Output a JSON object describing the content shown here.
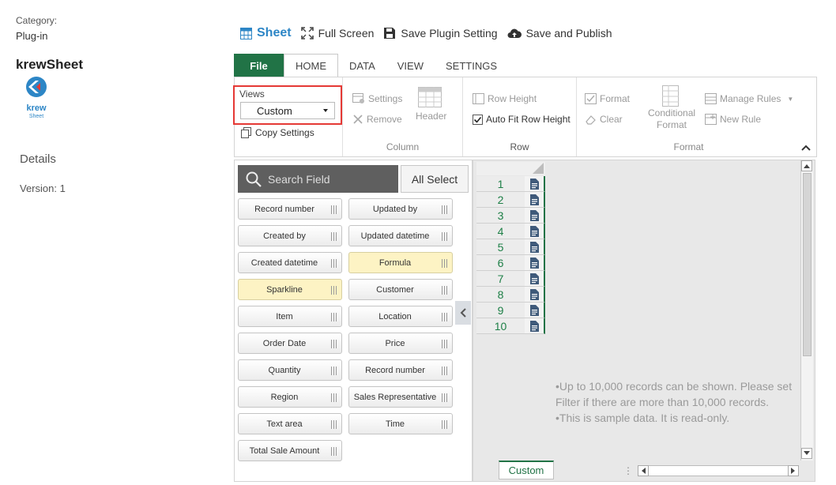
{
  "sidebar": {
    "category_label": "Category:",
    "category_value": "Plug-in",
    "plugin_name": "krewSheet",
    "logo_text": "krew",
    "logo_subtext": "Sheet",
    "details_label": "Details",
    "version_text": "Version: 1"
  },
  "toolbar": {
    "sheet_label": "Sheet",
    "fullscreen_label": "Full Screen",
    "save_plugin_label": "Save Plugin Setting",
    "save_publish_label": "Save and Publish"
  },
  "tabs": [
    "File",
    "HOME",
    "DATA",
    "VIEW",
    "SETTINGS"
  ],
  "ribbon": {
    "views_label": "Views",
    "views_selected": "Custom",
    "copy_settings": "Copy Settings",
    "column": {
      "settings": "Settings",
      "remove": "Remove",
      "header": "Header",
      "label": "Column"
    },
    "row": {
      "row_height": "Row Height",
      "auto_fit": "Auto Fit Row Height",
      "label": "Row"
    },
    "format": {
      "format": "Format",
      "clear": "Clear",
      "conditional_line1": "Conditional",
      "conditional_line2": "Format",
      "manage_rules": "Manage Rules",
      "new_rule": "New Rule",
      "label": "Format"
    }
  },
  "field_panel": {
    "search_placeholder": "Search Field",
    "all_select": "All Select",
    "fields": [
      {
        "label": "Record number",
        "highlight": false
      },
      {
        "label": "Updated by",
        "highlight": false
      },
      {
        "label": "Created by",
        "highlight": false
      },
      {
        "label": "Updated datetime",
        "highlight": false
      },
      {
        "label": "Created datetime",
        "highlight": false
      },
      {
        "label": "Formula",
        "highlight": true
      },
      {
        "label": "Sparkline",
        "highlight": true
      },
      {
        "label": "Customer",
        "highlight": false
      },
      {
        "label": "Item",
        "highlight": false
      },
      {
        "label": "Location",
        "highlight": false
      },
      {
        "label": "Order Date",
        "highlight": false
      },
      {
        "label": "Price",
        "highlight": false
      },
      {
        "label": "Quantity",
        "highlight": false
      },
      {
        "label": "Record number",
        "highlight": false
      },
      {
        "label": "Region",
        "highlight": false
      },
      {
        "label": "Sales Representative",
        "highlight": false
      },
      {
        "label": "Text area",
        "highlight": false
      },
      {
        "label": "Time",
        "highlight": false
      },
      {
        "label": "Total Sale Amount",
        "highlight": false
      }
    ]
  },
  "sheet": {
    "rows": [
      "1",
      "2",
      "3",
      "4",
      "5",
      "6",
      "7",
      "8",
      "9",
      "10"
    ],
    "note_line1": "•Up to 10,000 records can be shown. Please set Filter if there are more than 10,000 records.",
    "note_line2": "•This is sample data. It is read-only.",
    "tab_name": "Custom"
  },
  "colors": {
    "accent_green": "#217346",
    "brand_blue": "#2d86c6",
    "highlight_red": "#e53935",
    "highlight_yellow": "#fdf3c4"
  }
}
